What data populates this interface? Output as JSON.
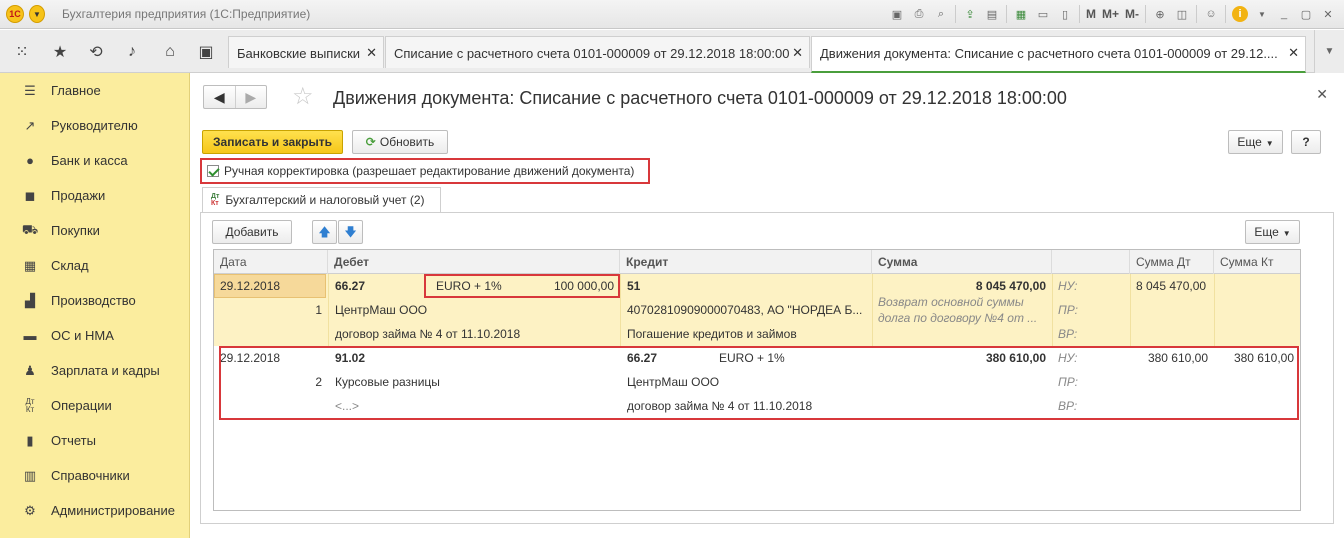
{
  "app": {
    "title": "Бухгалтерия предприятия  (1С:Предприятие)",
    "logo": "1С",
    "toolbar_texts": [
      "M",
      "M+",
      "M-"
    ]
  },
  "tabs": [
    {
      "label": "Банковские выписки"
    },
    {
      "label": "Списание с расчетного счета 0101-000009 от 29.12.2018 18:00:00"
    },
    {
      "label": "Движения документа: Списание с расчетного счета 0101-000009 от 29.12...."
    }
  ],
  "sidebar": {
    "items": [
      {
        "label": "Главное",
        "icon": "menu-icon"
      },
      {
        "label": "Руководителю",
        "icon": "trend-icon"
      },
      {
        "label": "Банк и касса",
        "icon": "coin-icon"
      },
      {
        "label": "Продажи",
        "icon": "bag-icon"
      },
      {
        "label": "Покупки",
        "icon": "cart-icon"
      },
      {
        "label": "Склад",
        "icon": "warehouse-icon"
      },
      {
        "label": "Производство",
        "icon": "factory-icon"
      },
      {
        "label": "ОС и НМА",
        "icon": "truck-icon"
      },
      {
        "label": "Зарплата и кадры",
        "icon": "person-icon"
      },
      {
        "label": "Операции",
        "icon": "dt-kt-icon"
      },
      {
        "label": "Отчеты",
        "icon": "bar-chart-icon"
      },
      {
        "label": "Справочники",
        "icon": "book-icon"
      },
      {
        "label": "Администрирование",
        "icon": "gear-icon"
      }
    ]
  },
  "page": {
    "title": "Движения документа: Списание с расчетного счета 0101-000009 от 29.12.2018 18:00:00",
    "save_close": "Записать и закрыть",
    "refresh": "Обновить",
    "more": "Еще",
    "help": "?",
    "manual_label": "Ручная корректировка (разрешает редактирование движений документа)",
    "manual_checked": true
  },
  "subtab": {
    "label": "Бухгалтерский и налоговый учет (2)",
    "icon_top": "Дт",
    "icon_bottom": "Кт"
  },
  "grid_toolbar": {
    "add": "Добавить",
    "more": "Еще"
  },
  "grid": {
    "columns": [
      "Дата",
      "Дебет",
      "Кредит",
      "Сумма",
      "",
      "Сумма Дт",
      "Сумма Кт"
    ],
    "rows": [
      {
        "date": "29.12.2018",
        "n": "1",
        "debit_account": "66.27",
        "debit_currency": "EURO + 1%",
        "debit_amount": "100 000,00",
        "debit_sub1": "ЦентрМаш ООО",
        "debit_sub2": "договор займа № 4 от 11.10.2018",
        "credit_account": "51",
        "credit_currency": "",
        "credit_sub1": "40702810909000070483, АО \"НОРДЕА Б...",
        "credit_sub2": "Погашение кредитов и займов",
        "sum": "8 045 470,00",
        "content": "Возврат основной суммы долга по договору №4 от ...",
        "nu": "НУ:",
        "pr": "ПР:",
        "vr": "ВР:",
        "sum_dt": "8 045 470,00",
        "sum_kt": ""
      },
      {
        "date": "29.12.2018",
        "n": "2",
        "debit_account": "91.02",
        "debit_currency": "",
        "debit_amount": "",
        "debit_sub1": "Курсовые разницы",
        "debit_sub2": "<...>",
        "credit_account": "66.27",
        "credit_currency": "EURO + 1%",
        "credit_sub1": "ЦентрМаш ООО",
        "credit_sub2": "договор займа № 4 от 11.10.2018",
        "sum": "380 610,00",
        "content": "",
        "nu": "НУ:",
        "pr": "ПР:",
        "vr": "ВР:",
        "sum_dt": "380 610,00",
        "sum_kt": "380 610,00"
      }
    ]
  },
  "colors": {
    "sidebar_bg": "#fbed9e",
    "selected_row": "#fdf2c4",
    "highlight_box": "#d8383b",
    "primary_button": "#f6c719",
    "active_tab_underline": "#4a9e3c"
  }
}
